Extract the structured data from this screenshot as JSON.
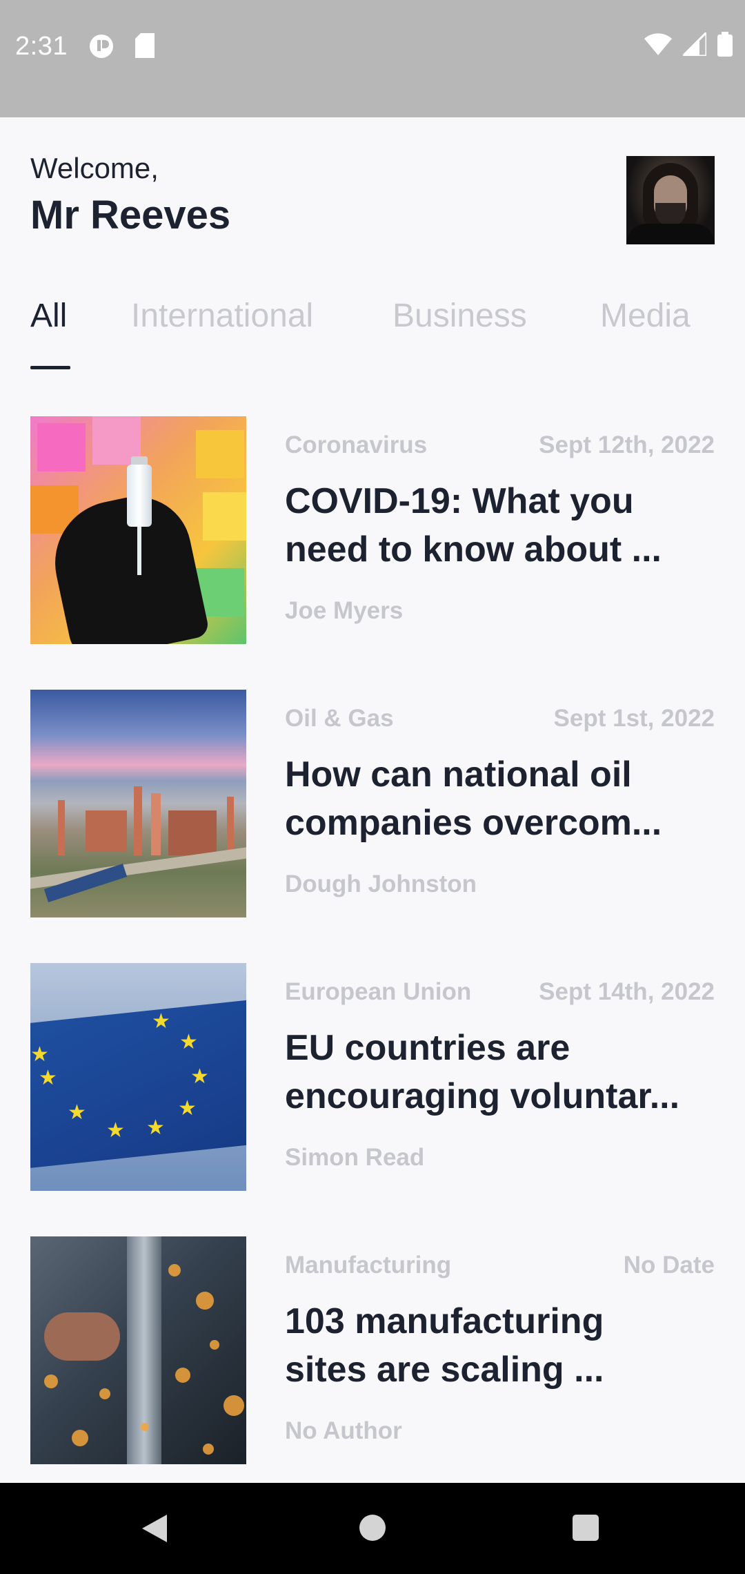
{
  "status_bar": {
    "time": "2:31",
    "icons_left": [
      "pause-badge-icon",
      "sd-card-icon"
    ],
    "icons_right": [
      "wifi-icon",
      "cell-signal-icon",
      "battery-icon"
    ]
  },
  "header": {
    "greeting": "Welcome,",
    "user_name": "Mr Reeves",
    "avatar": "profile-photo"
  },
  "tabs": [
    {
      "label": "All",
      "active": true
    },
    {
      "label": "International",
      "active": false
    },
    {
      "label": "Business",
      "active": false
    },
    {
      "label": "Media",
      "active": false
    }
  ],
  "articles": [
    {
      "category": "Coronavirus",
      "date": "Sept 12th, 2022",
      "title_lines": [
        "COVID-19: What you",
        "need to know about ..."
      ],
      "author": "Joe Myers",
      "image": "vaccine-vial"
    },
    {
      "category": "Oil & Gas",
      "date": "Sept 1st, 2022",
      "title_lines": [
        "How can national oil",
        "companies overcom..."
      ],
      "author": "Dough Johnston",
      "image": "refinery"
    },
    {
      "category": "European Union",
      "date": "Sept 14th, 2022",
      "title_lines": [
        "EU countries are",
        "encouraging voluntar..."
      ],
      "author": "Simon Read",
      "image": "eu-flag"
    },
    {
      "category": "Manufacturing",
      "date": "No Date",
      "title_lines": [
        "103 manufacturing",
        "sites are scaling ..."
      ],
      "author": "No Author",
      "image": "welding-sparks"
    }
  ],
  "nav_bar": {
    "buttons": [
      "back-icon",
      "home-icon",
      "recents-icon"
    ]
  },
  "colors": {
    "background": "#f8f8fa",
    "text_primary": "#1d2230",
    "text_muted": "#c6c7cd",
    "status_bar": "#b7b7b7",
    "nav_bar": "#000000"
  }
}
